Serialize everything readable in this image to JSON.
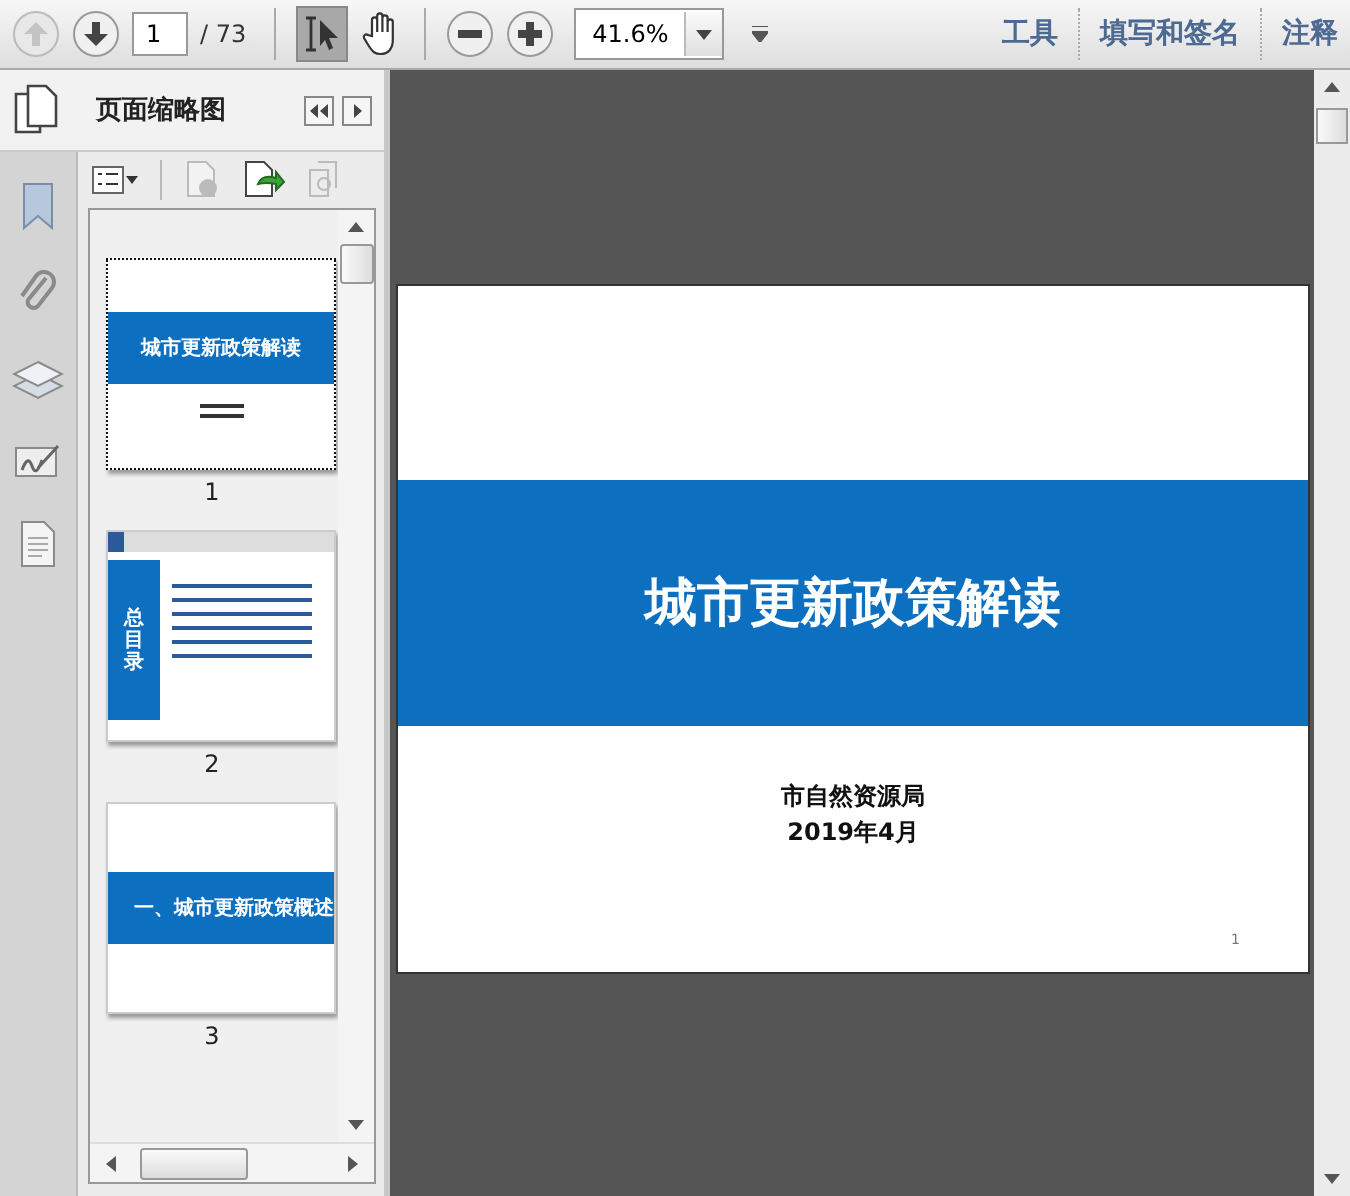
{
  "toolbar": {
    "page_number": "1",
    "page_total": "/ 73",
    "zoom": "41.6%",
    "links": [
      "工具",
      "填写和签名",
      "注释"
    ]
  },
  "panel": {
    "title": "页面缩略图",
    "thumbnails": [
      {
        "label": "1",
        "selected": true,
        "kind": "cover",
        "title": "城市更新政策解读"
      },
      {
        "label": "2",
        "selected": false,
        "kind": "contents",
        "title": "总目录"
      },
      {
        "label": "3",
        "selected": false,
        "kind": "section",
        "title": "一、城市更新政策概述"
      }
    ]
  },
  "page": {
    "title": "城市更新政策解读",
    "author": "市自然资源局",
    "date": "2019年4月",
    "page_number": "1"
  }
}
